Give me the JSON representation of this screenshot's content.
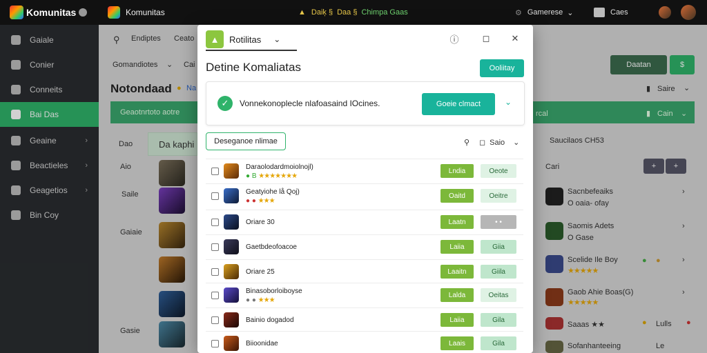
{
  "topbar": {
    "brand": "Komunitas",
    "app_name": "Komunitas",
    "center_text": "Daik § Daa § Chimpa Gaas",
    "center_lead": "Daiķ §",
    "center_mid": "Daa §",
    "center_tail": "Chimpa Gaas",
    "right_text": "Gamerese",
    "right_link": "Caes"
  },
  "sidebar": {
    "items": [
      {
        "label": "Gaiale"
      },
      {
        "label": "Conier"
      },
      {
        "label": "Conneits"
      },
      {
        "label": "Bai Das"
      },
      {
        "label": "Geaine"
      },
      {
        "label": "Beactieles"
      },
      {
        "label": "Geagetios"
      },
      {
        "label": "Bin Coy"
      }
    ]
  },
  "background": {
    "search_label": "Endiptes",
    "search_tag": "Ceato",
    "filter_label": "Gomandiotes",
    "filter_label2": "Cai",
    "page_title": "Notondaad",
    "title_badge": "Na",
    "save_label": "Saire",
    "band_text": "Geaotnrtoto aotre",
    "band_right": "Cain",
    "band_right_label": "rcal",
    "tab_left": "Dao",
    "tab_left2": "Da kaphi",
    "col_left": "Aio",
    "col_left2": "Saile",
    "col_left3": "Gaiaie",
    "col_left4": "Gasie",
    "right_header": "Saucilaos CH53",
    "right_sub": "Cari",
    "right_items": [
      {
        "name": "Sacnbefeaiks",
        "sub": "O oaia- ofay"
      },
      {
        "name": "Saomis Adets",
        "sub": "O Gase"
      },
      {
        "name": "Scelide Ile Boy",
        "sub": "★★★★★"
      },
      {
        "name": "Gaob Ahie Boas(G)",
        "sub": "★★★★★"
      },
      {
        "name": "Saaas ★★",
        "sub": "Lulls"
      },
      {
        "name": "Sofanhanteeing",
        "sub": "Le"
      }
    ],
    "top_right_btn": "Daatan",
    "right_top_label": "Daatan"
  },
  "modal": {
    "tab_title": "Rotilitas",
    "heading": "Detine Komaliatas",
    "top_button": "Ooliitay",
    "notice_text": "Vonnekonoplecle nlafoasaind IOcines.",
    "notice_button": "Goeie clmact",
    "filter_tab": "Deseganoe nlimae",
    "sort_label": "Saio",
    "rows": [
      {
        "name": "Daraolodardmoiolnojl)",
        "sub": "★★★★★★★",
        "sub_prefix": "● B",
        "b1": "Lndia",
        "b2": "Oeote",
        "b2_style": "light"
      },
      {
        "name": "Geatyiohe lå Qoj)",
        "sub": "★★★",
        "sub_prefix": "● ●",
        "b1": "Oaitd",
        "b2": "Oeitre",
        "b2_style": "light"
      },
      {
        "name": "Oriare  30",
        "sub": "",
        "sub_prefix": "",
        "b1": "Laatn",
        "b2": "• •",
        "b2_style": "gray"
      },
      {
        "name": "Gaetbdeofoacoe",
        "sub": "",
        "sub_prefix": "",
        "b1": "Laiia",
        "b2": "Giia",
        "b2_style": "mint"
      },
      {
        "name": "Oriare  25",
        "sub": "",
        "sub_prefix": "",
        "b1": "Laaitn",
        "b2": "Giila",
        "b2_style": "mint"
      },
      {
        "name": "Binasoborloiboyse",
        "sub": "★★★",
        "sub_prefix": "● ●",
        "b1": "Lalda",
        "b2": "Oeitas",
        "b2_style": "light"
      },
      {
        "name": "Bainio dogadod",
        "sub": "",
        "sub_prefix": "",
        "b1": "Laiia",
        "b2": "Gila",
        "b2_style": "mint"
      },
      {
        "name": "Biioonidae",
        "sub": "",
        "sub_prefix": "",
        "b1": "Laais",
        "b2": "Gila",
        "b2_style": "mint"
      }
    ]
  },
  "colors": {
    "accent_green": "#2fb36a",
    "teal": "#19b39b",
    "lime": "#7cb83a",
    "sidebar_bg": "#2a2d30"
  }
}
